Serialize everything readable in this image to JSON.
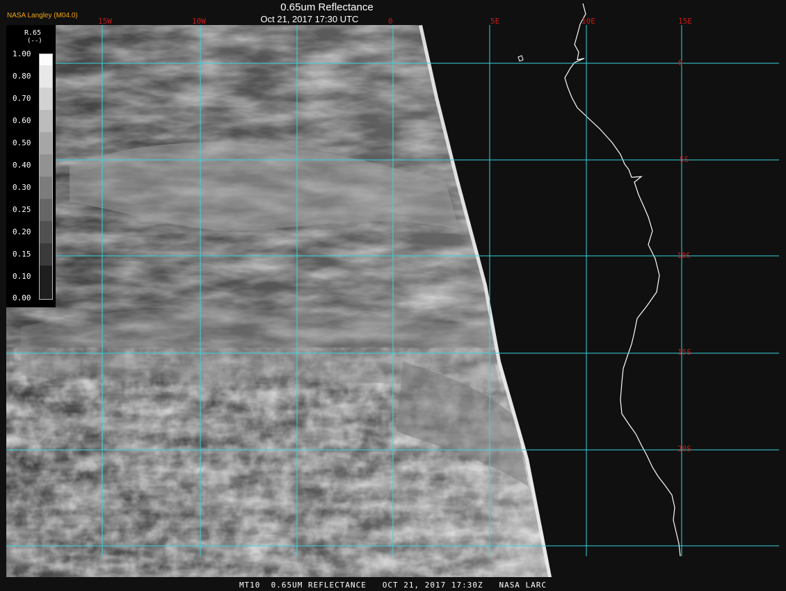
{
  "header": {
    "title": "0.65um Reflectance",
    "subtitle": "Oct 21, 2017 17:30 UTC",
    "org": "NASA Langley (M04.0)"
  },
  "footer": {
    "text": "MT10  0.65UM REFLECTANCE   OCT 21, 2017 17:30Z   NASA LARC"
  },
  "legend": {
    "title": "R.65",
    "units": "(--)",
    "ticks": [
      "1.00",
      "0.80",
      "0.70",
      "0.60",
      "0.50",
      "0.40",
      "0.30",
      "0.25",
      "0.20",
      "0.15",
      "0.10",
      "0.00"
    ]
  },
  "grid": {
    "longitude_labels": [
      "15W",
      "10W",
      "0",
      "5E",
      "10E",
      "15E"
    ],
    "latitude_labels": [
      "0",
      "5S",
      "10S",
      "15S",
      "20S"
    ],
    "color": "#35d6e0"
  },
  "colors": {
    "background": "#000000",
    "gridline": "#35d6e0",
    "grid_label": "#c81b1b",
    "org_label": "#f2a516",
    "coastline": "#ffffff"
  }
}
